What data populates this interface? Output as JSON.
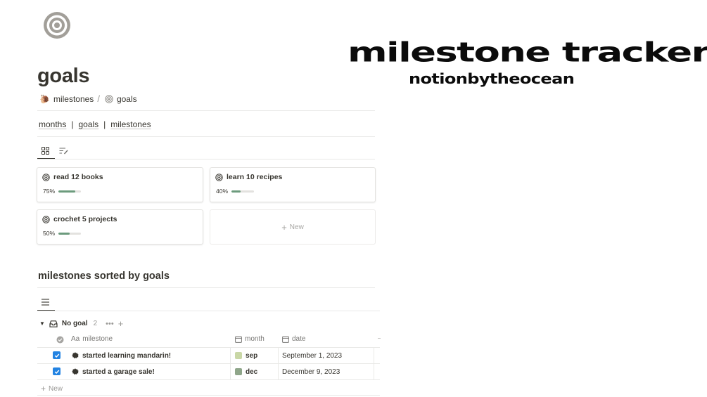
{
  "page": {
    "title": "goals",
    "icon": "target-icon"
  },
  "breadcrumb": {
    "items": [
      {
        "label": "milestones",
        "icon": "snail-icon"
      },
      {
        "label": "goals",
        "icon": "target-icon"
      }
    ],
    "separator": "/"
  },
  "links": {
    "items": [
      "months",
      "goals",
      "milestones"
    ],
    "separator": "|"
  },
  "gallery": {
    "views": [
      "gallery-view-icon",
      "sorted-list-view-icon"
    ],
    "cards": [
      {
        "title": "read 12 books",
        "progress_label": "75%",
        "progress": 0.75
      },
      {
        "title": "learn 10 recipes",
        "progress_label": "40%",
        "progress": 0.4
      },
      {
        "title": "crochet 5 projects",
        "progress_label": "50%",
        "progress": 0.5
      }
    ],
    "new_label": "New"
  },
  "milestones_section": {
    "title": "milestones sorted by goals",
    "view_icon": "list-view-icon",
    "group": {
      "name": "No goal",
      "count": "2"
    },
    "columns": {
      "prefix": "Aa",
      "milestone": "milestone",
      "month": "month",
      "date": "date"
    },
    "rows": [
      {
        "checked": true,
        "milestone": "started learning mandarin!",
        "month": "sep",
        "date": "September 1, 2023"
      },
      {
        "checked": true,
        "milestone": "started a garage sale!",
        "month": "dec",
        "date": "December 9, 2023"
      }
    ],
    "new_label": "New"
  },
  "banner": {
    "title": "milestone tracker",
    "subtitle": "notionbytheocean"
  },
  "colors": {
    "text": "#37352f",
    "progress_fill": "#6c9b7d",
    "checkbox": "#2383e2",
    "icon_gray": "#a29f99"
  }
}
